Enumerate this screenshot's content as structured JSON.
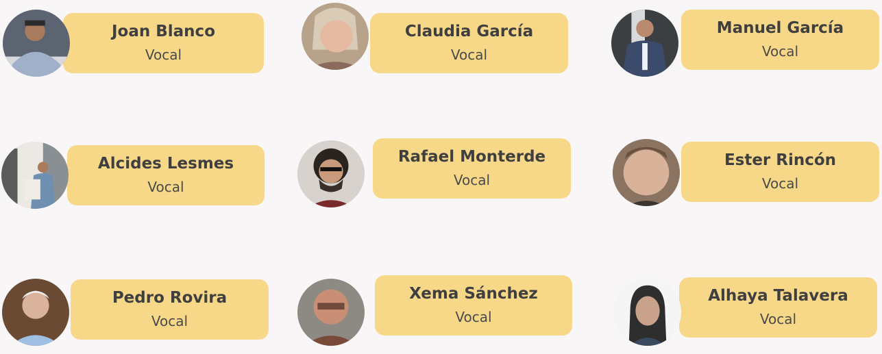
{
  "members": [
    {
      "name": "Joan Blanco",
      "role": "Vocal"
    },
    {
      "name": "Claudia García",
      "role": "Vocal"
    },
    {
      "name": "Manuel García",
      "role": "Vocal"
    },
    {
      "name": "Alcides Lesmes",
      "role": "Vocal"
    },
    {
      "name": "Rafael Monterde",
      "role": "Vocal"
    },
    {
      "name": "Ester Rincón",
      "role": "Vocal"
    },
    {
      "name": "Pedro Rovira",
      "role": "Vocal"
    },
    {
      "name": "Xema Sánchez",
      "role": "Vocal"
    },
    {
      "name": "Alhaya Talavera",
      "role": "Vocal"
    }
  ],
  "colors": {
    "background": "#f8f6f7",
    "card": "#f7d889",
    "text": "#3f3f3f"
  },
  "icons": [
    "portrait-photo"
  ]
}
